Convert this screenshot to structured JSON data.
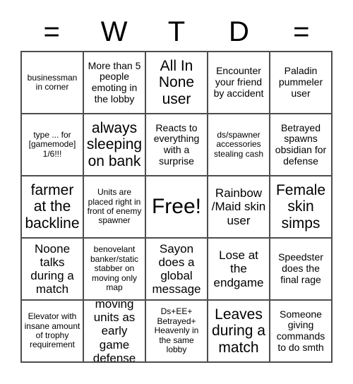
{
  "card": {
    "title_letters": [
      "=",
      "W",
      "T",
      "D",
      "="
    ],
    "free_space_label": "Free!",
    "rows": [
      [
        {
          "text": "businessman in corner",
          "size": "fs-s"
        },
        {
          "text": "More than 5 people emoting in the lobby",
          "size": "fs-m"
        },
        {
          "text": "All In None user",
          "size": "fs-xl"
        },
        {
          "text": "Encounter your friend by accident",
          "size": "fs-m"
        },
        {
          "text": "Paladin pummeler user",
          "size": "fs-m"
        }
      ],
      [
        {
          "text": "type ... for [gamemode] 1/6!!!",
          "size": "fs-s"
        },
        {
          "text": "always sleeping on bank",
          "size": "fs-xl"
        },
        {
          "text": "Reacts to everything with a surprise",
          "size": "fs-m"
        },
        {
          "text": "ds/spawner accessories stealing cash",
          "size": "fs-s"
        },
        {
          "text": "Betrayed spawns obsidian for defense",
          "size": "fs-m"
        }
      ],
      [
        {
          "text": "farmer at the backline",
          "size": "fs-xl"
        },
        {
          "text": "Units are placed right in front of enemy spawner",
          "size": "fs-s"
        },
        {
          "text": "Free!",
          "size": "fs-xxl"
        },
        {
          "text": "Rainbow /Maid skin user",
          "size": "fs-l"
        },
        {
          "text": "Female skin simps",
          "size": "fs-xl"
        }
      ],
      [
        {
          "text": "Noone talks during a match",
          "size": "fs-l"
        },
        {
          "text": "benovelant banker/static stabber on moving only map",
          "size": "fs-s"
        },
        {
          "text": "Sayon does a global message",
          "size": "fs-l"
        },
        {
          "text": "Lose at the endgame",
          "size": "fs-l"
        },
        {
          "text": "Speedster does the final rage",
          "size": "fs-m"
        }
      ],
      [
        {
          "text": "Elevator with insane amount of trophy requirement",
          "size": "fs-s"
        },
        {
          "text": "moving units as early game defense",
          "size": "fs-l"
        },
        {
          "text": "Ds+EE+ Betrayed+ Heavenly in the same lobby",
          "size": "fs-s"
        },
        {
          "text": "Leaves during a match",
          "size": "fs-xl"
        },
        {
          "text": "Someone giving commands to do smth",
          "size": "fs-m"
        }
      ]
    ]
  },
  "colors": {
    "background": "#ffffff",
    "grid_line": "#4d4d4d",
    "text": "#000000"
  }
}
